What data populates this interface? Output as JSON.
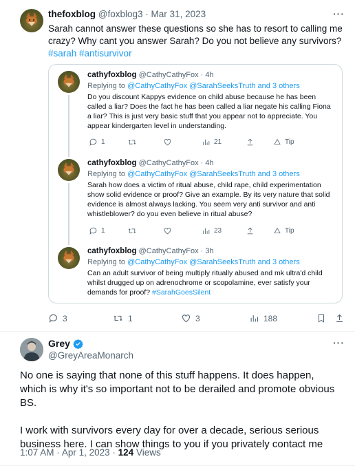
{
  "top_tweet": {
    "display_name": "thefoxblog",
    "handle": "@foxblog3",
    "sep": "·",
    "date": "Mar 31, 2023",
    "text": "Sarah cannot answer these questions so she has to resort to calling me crazy? Why cant you answer Sarah? Do you not believe any survivors?",
    "hashtags": "#sarah #antisurvivor",
    "more": "···",
    "actions": {
      "reply": "3",
      "retweet": "1",
      "like": "3",
      "views": "188"
    }
  },
  "quoted": [
    {
      "display_name": "cathyfoxblog",
      "handle": "@CathyCathyFox",
      "time": "· 4h",
      "replying_prefix": "Replying to",
      "replying_to": "@CathyCathyFox @SarahSeeksTruth and 3 others",
      "text": "Do you discount Kappys evidence on child abuse because he has been called a liar? Does the fact he has been called a liar negate his calling Fiona a liar? This is just very basic stuff that you appear not to appreciate. You appear kindergarten level in understanding.",
      "reply_count": "1",
      "views": "21",
      "tip": "Tip"
    },
    {
      "display_name": "cathyfoxblog",
      "handle": "@CathyCathyFox",
      "time": "· 4h",
      "replying_prefix": "Replying to",
      "replying_to": "@CathyCathyFox @SarahSeeksTruth and 3 others",
      "text": "Sarah how does a victim of ritual abuse, child rape, child experimentation show solid evidence or proof? Give an example.  By its very nature that solid evidence is almost always lacking. You seem very anti survivor and anti whistleblower? do you even believe in ritual abuse?",
      "reply_count": "1",
      "views": "23",
      "tip": "Tip"
    },
    {
      "display_name": "cathyfoxblog",
      "handle": "@CathyCathyFox",
      "time": "· 3h",
      "replying_prefix": "Replying to",
      "replying_to": "@CathyCathyFox @SarahSeeksTruth and 3 others",
      "text": "Can an adult survivor of being multiply ritually abused and mk ultra'd child whilst drugged up on adrenochrome or scopolamine, ever satisfy your demands for proof?",
      "hashtag": "#SarahGoesSilent"
    }
  ],
  "reply_tweet": {
    "display_name": "Grey",
    "handle": "@GreyAreaMonarch",
    "verified": true,
    "more": "···",
    "paragraph1": "No one is saying that none of this stuff happens. It does happen, which is why it's so important not to be derailed and promote obvious BS.",
    "paragraph2": "I work with survivors every day for over a decade, serious serious business here. I can show things to you if you privately contact me",
    "time": "1:07 AM",
    "sep": "·",
    "date": "Apr 1, 2023",
    "sep2": "·",
    "views_count": "124",
    "views_label": "Views"
  },
  "colors": {
    "accent": "#1d9bf0",
    "muted": "#536471",
    "text": "#0f1419",
    "border": "#cfd9de"
  }
}
